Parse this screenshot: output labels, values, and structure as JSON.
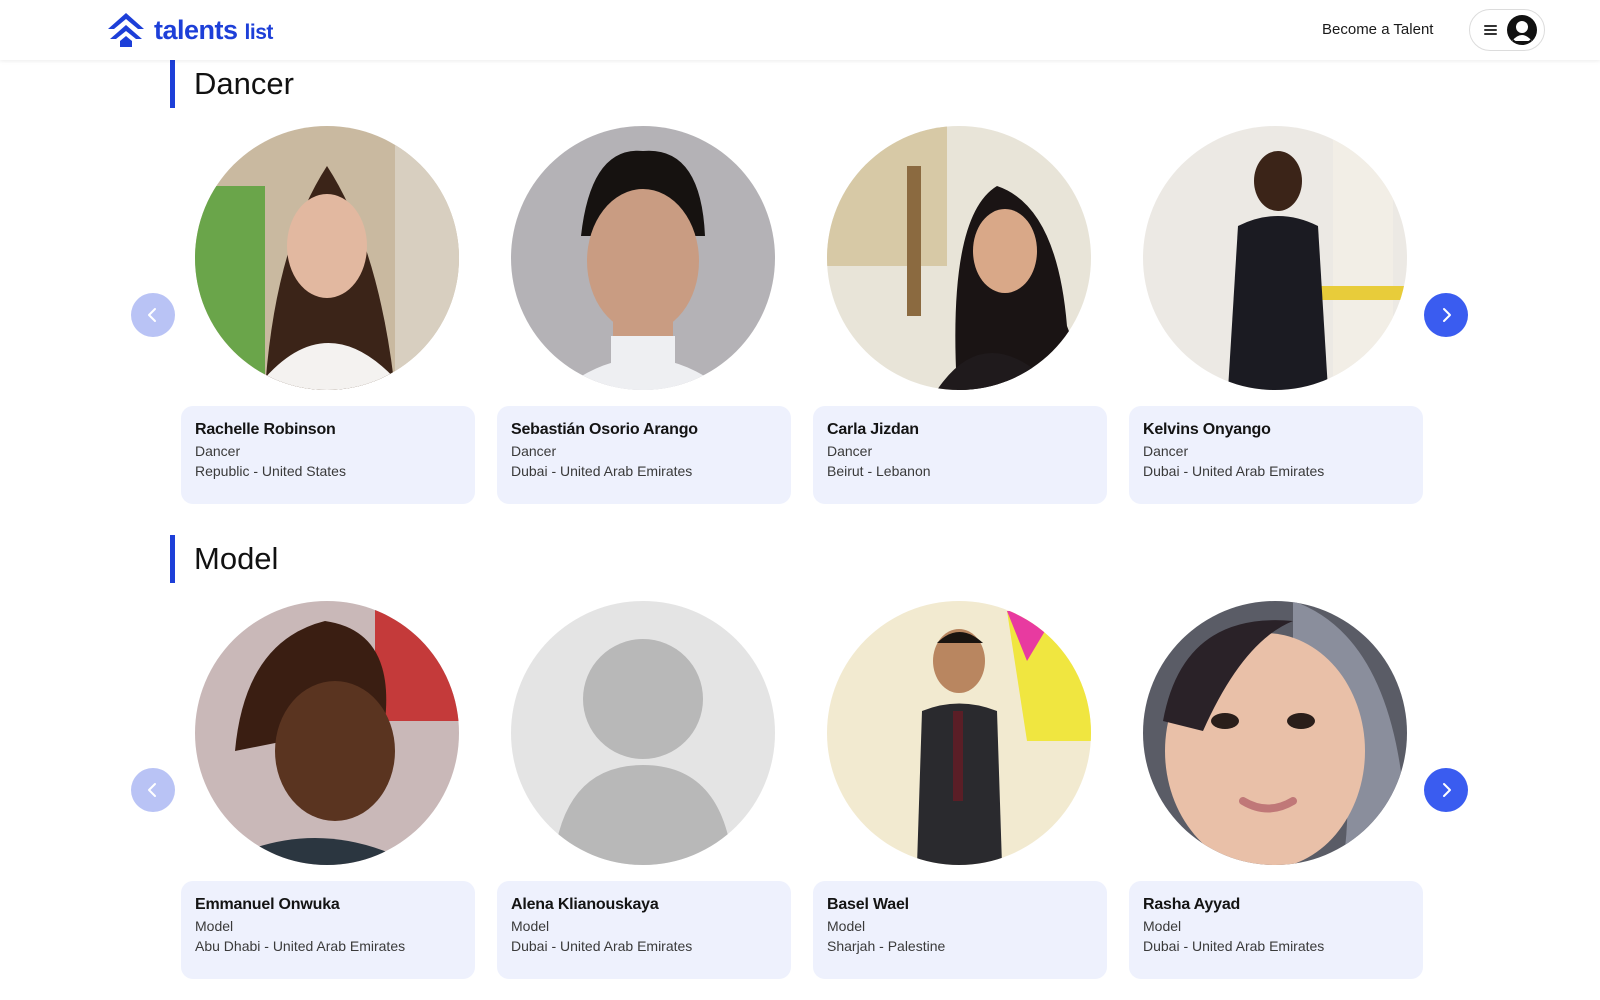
{
  "header": {
    "logo_main": "talents",
    "logo_sub": "list",
    "become_talent": "Become a Talent"
  },
  "colors": {
    "brand": "#1d3fd8",
    "card_bg": "#eef1fd",
    "arrow_active": "#3a5cf0",
    "arrow_disabled": "#b9c3f5"
  },
  "sections": [
    {
      "title": "Dancer",
      "talents": [
        {
          "name": "Rachelle Robinson",
          "role": "Dancer",
          "location": "Republic - United States"
        },
        {
          "name": "Sebastián Osorio Arango",
          "role": "Dancer",
          "location": "Dubai - United Arab Emirates"
        },
        {
          "name": "Carla Jizdan",
          "role": "Dancer",
          "location": "Beirut - Lebanon"
        },
        {
          "name": "Kelvins Onyango",
          "role": "Dancer",
          "location": "Dubai - United Arab Emirates"
        }
      ]
    },
    {
      "title": "Model",
      "talents": [
        {
          "name": "Emmanuel Onwuka",
          "role": "Model",
          "location": "Abu Dhabi - United Arab Emirates"
        },
        {
          "name": "Alena Klianouskaya",
          "role": "Model",
          "location": "Dubai - United Arab Emirates"
        },
        {
          "name": "Basel Wael",
          "role": "Model",
          "location": "Sharjah - Palestine"
        },
        {
          "name": "Rasha Ayyad",
          "role": "Model",
          "location": "Dubai - United Arab Emirates"
        }
      ]
    }
  ],
  "icons": {
    "logo": "double-chevron-up-logo-icon",
    "menu": "hamburger-icon",
    "avatar": "user-avatar-icon",
    "prev": "chevron-left-icon",
    "next": "chevron-right-icon",
    "placeholder": "default-profile-icon"
  }
}
